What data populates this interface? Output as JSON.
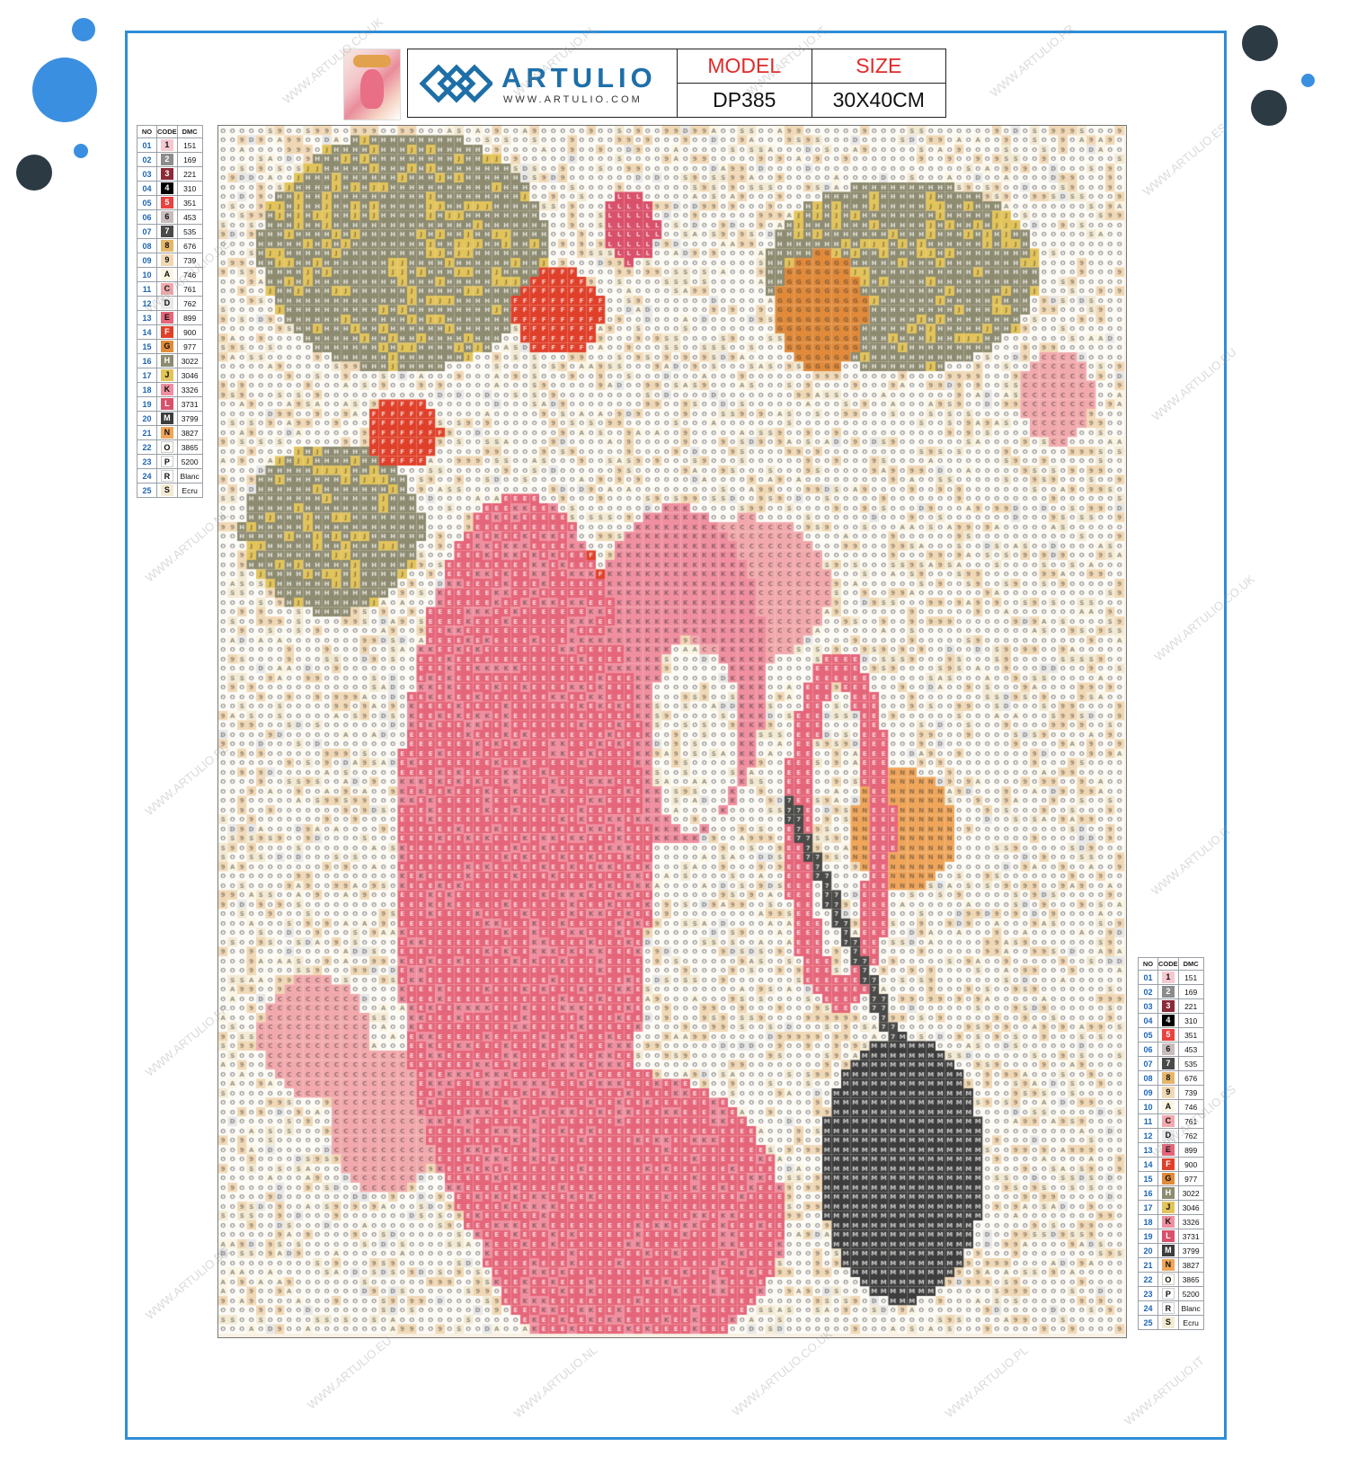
{
  "brand": {
    "name": "ARTULIO",
    "url": "WWW.ARTULIO.COM"
  },
  "product": {
    "model_label": "MODEL",
    "model_value": "DP385",
    "size_label": "SIZE",
    "size_value": "30X40CM"
  },
  "legend": {
    "headers": [
      "NO",
      "CODE",
      "DMC"
    ],
    "rows": [
      {
        "no": "01",
        "code": "1",
        "dmc": "151",
        "color": "#f6c9d0"
      },
      {
        "no": "02",
        "code": "2",
        "dmc": "169",
        "color": "#8c8c8c"
      },
      {
        "no": "03",
        "code": "3",
        "dmc": "221",
        "color": "#8c2a38"
      },
      {
        "no": "04",
        "code": "4",
        "dmc": "310",
        "color": "#000000"
      },
      {
        "no": "05",
        "code": "5",
        "dmc": "351",
        "color": "#e9423f"
      },
      {
        "no": "06",
        "code": "6",
        "dmc": "453",
        "color": "#c8bcbc"
      },
      {
        "no": "07",
        "code": "7",
        "dmc": "535",
        "color": "#4a4a48"
      },
      {
        "no": "08",
        "code": "8",
        "dmc": "676",
        "color": "#e5b66a"
      },
      {
        "no": "09",
        "code": "9",
        "dmc": "739",
        "color": "#f1d8b5"
      },
      {
        "no": "10",
        "code": "A",
        "dmc": "746",
        "color": "#fbf5e4"
      },
      {
        "no": "11",
        "code": "C",
        "dmc": "761",
        "color": "#f2a9ad"
      },
      {
        "no": "12",
        "code": "D",
        "dmc": "762",
        "color": "#e8e8e8"
      },
      {
        "no": "13",
        "code": "E",
        "dmc": "899",
        "color": "#e5667a"
      },
      {
        "no": "14",
        "code": "F",
        "dmc": "900",
        "color": "#e0402a"
      },
      {
        "no": "15",
        "code": "G",
        "dmc": "977",
        "color": "#e08a3a"
      },
      {
        "no": "16",
        "code": "H",
        "dmc": "3022",
        "color": "#8d8b70"
      },
      {
        "no": "17",
        "code": "J",
        "dmc": "3046",
        "color": "#e3c45b"
      },
      {
        "no": "18",
        "code": "K",
        "dmc": "3326",
        "color": "#f08fa0"
      },
      {
        "no": "19",
        "code": "L",
        "dmc": "3731",
        "color": "#d9506b"
      },
      {
        "no": "20",
        "code": "M",
        "dmc": "3799",
        "color": "#3d3d3d"
      },
      {
        "no": "21",
        "code": "N",
        "dmc": "3827",
        "color": "#f0a65a"
      },
      {
        "no": "22",
        "code": "O",
        "dmc": "3865",
        "color": "#fdfbf6"
      },
      {
        "no": "23",
        "code": "P",
        "dmc": "5200",
        "color": "#ffffff"
      },
      {
        "no": "24",
        "code": "R",
        "dmc": "Blanc",
        "color": "#ffffff"
      },
      {
        "no": "25",
        "code": "S",
        "dmc": "Ecru",
        "color": "#f3ead3"
      }
    ]
  },
  "watermarks": [
    "WWW.ARTULIO.CO.UK",
    "WWW.ARTULIO.PL",
    "WWW.ARTULIO.IT",
    "WWW.ARTULIO.FR",
    "WWW.ARTULIO.ES",
    "WWW.ARTULIO.DE",
    "WWW.ARTULIO.EU",
    "WWW.ARTULIO.NL"
  ],
  "colors": {
    "frame_border": "#2f8dd6",
    "accent_blue": "#1e6fa8",
    "header_red": "#e12a2a",
    "dot_blue": "#3a8fe0",
    "dot_dark": "#2c3a43"
  }
}
